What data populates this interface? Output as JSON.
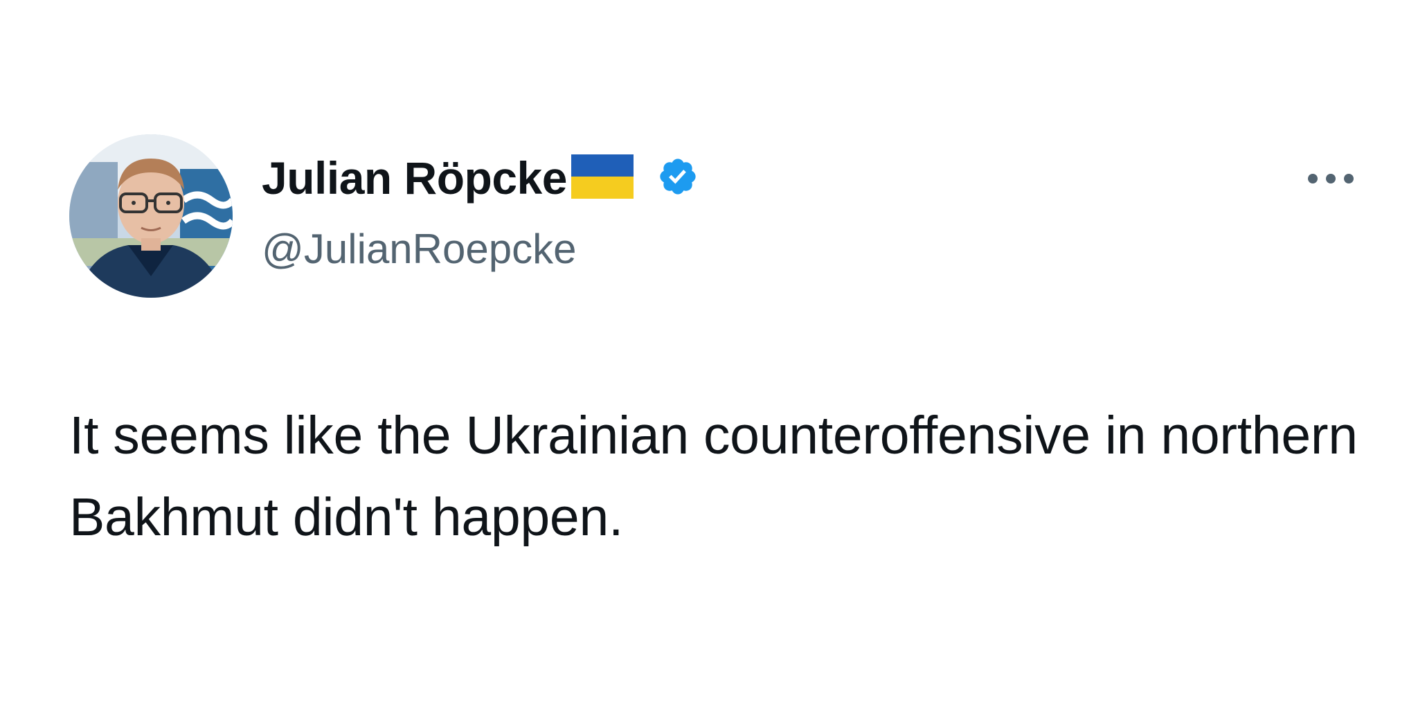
{
  "author": {
    "display_name": "Julian Röpcke",
    "handle": "@JulianRoepcke",
    "flag_icon": "ukraine-flag-icon",
    "verified_icon": "verified-badge-icon",
    "colors": {
      "flag_blue": "#1f5fb8",
      "flag_yellow": "#f5cc1f",
      "verified_blue": "#1d9bf0",
      "handle_gray": "#536471"
    }
  },
  "menu": {
    "icon": "more-horizontal-icon"
  },
  "tweet": {
    "text": "It seems like the Ukrainian counteroffensive in northern Bakhmut didn't happen."
  }
}
